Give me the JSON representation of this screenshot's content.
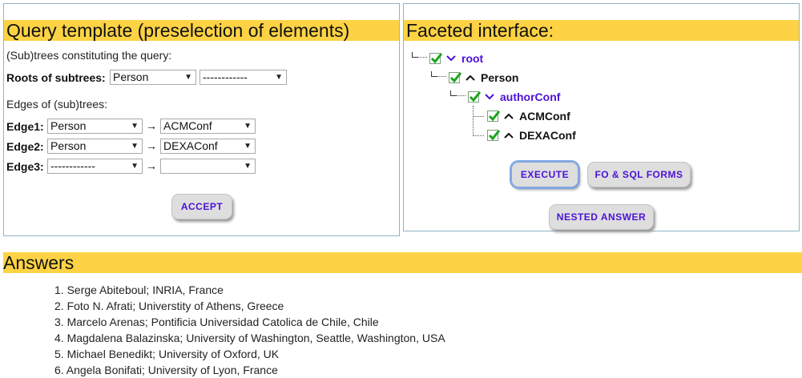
{
  "query_panel": {
    "title": "Query template (preselection of elements)",
    "subtrees_label": "(Sub)trees constituting the query:",
    "roots_label": "Roots of subtrees:",
    "roots": [
      "Person",
      "------------"
    ],
    "edges_label": "Edges of (sub)trees:",
    "edges": [
      {
        "label": "Edge1:",
        "from": "Person",
        "to": "ACMConf"
      },
      {
        "label": "Edge2:",
        "from": "Person",
        "to": "DEXAConf"
      },
      {
        "label": "Edge3:",
        "from": "------------",
        "to": ""
      }
    ],
    "arrow": "→",
    "accept_label": "ACCEPT"
  },
  "facet_panel": {
    "title": "Faceted interface:",
    "tree": [
      {
        "label": "root",
        "expanded": true,
        "checked": true
      },
      {
        "label": "Person",
        "expanded": false,
        "checked": true
      },
      {
        "label": "authorConf",
        "expanded": true,
        "checked": true
      },
      {
        "label": "ACMConf",
        "expanded": false,
        "checked": true
      },
      {
        "label": "DEXAConf",
        "expanded": false,
        "checked": true
      }
    ],
    "execute_label": "EXECUTE",
    "forms_label": "FO & SQL FORMS",
    "nested_label": "NESTED ANSWER"
  },
  "answers": {
    "title": "Answers",
    "items": [
      "1. Serge Abiteboul; INRIA, France",
      "2. Foto N. Afrati; Universtity of Athens, Greece",
      "3. Marcelo Arenas; Pontificia Universidad Catolica de Chile, Chile",
      "4. Magdalena Balazinska; University of Washington, Seattle, Washington, USA",
      "5. Michael Benedikt; University of Oxford, UK",
      "6. Angela Bonifati; University of Lyon, France"
    ]
  },
  "colors": {
    "heading_bg": "#fdd345",
    "link_blue": "#4b12d6",
    "panel_border": "#8fb4c6"
  }
}
